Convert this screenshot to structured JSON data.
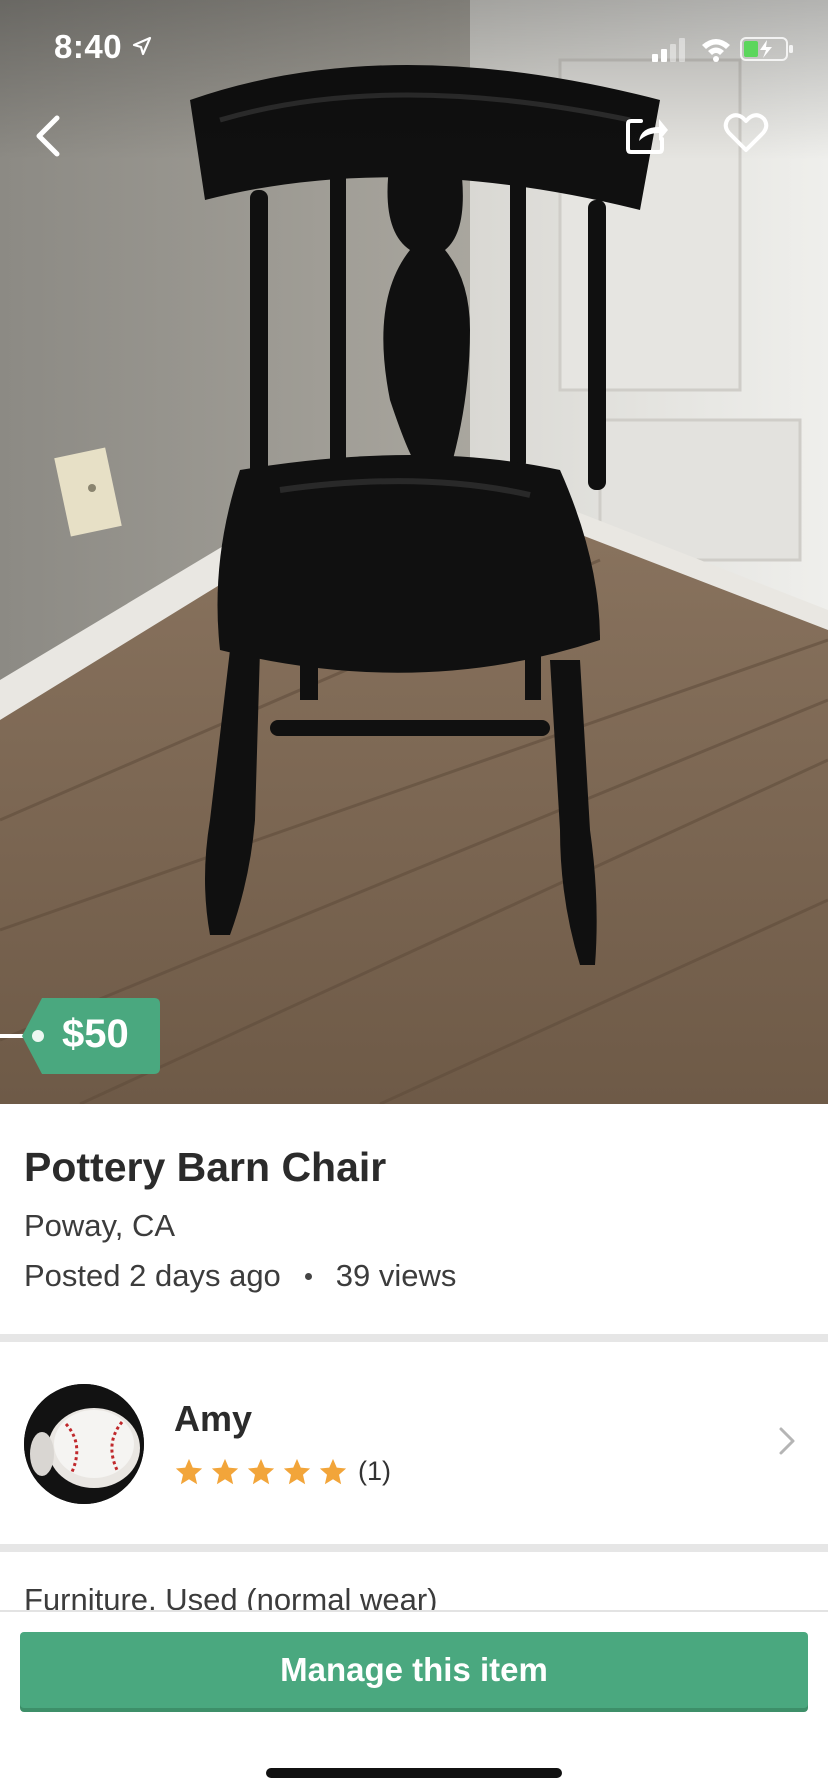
{
  "status_bar": {
    "time": "8:40"
  },
  "listing": {
    "price": "$50",
    "title": "Pottery Barn Chair",
    "location": "Poway, CA",
    "posted": "Posted 2 days ago",
    "views": "39 views",
    "details": "Furniture, Used (normal wear)"
  },
  "seller": {
    "name": "Amy",
    "rating_stars": 5,
    "rating_count": "(1)"
  },
  "actions": {
    "manage_label": "Manage this item"
  },
  "icons": {
    "back": "chevron-left-icon",
    "share": "share-icon",
    "favorite": "heart-icon",
    "seller_chevron": "chevron-right-icon",
    "star": "star-icon"
  },
  "colors": {
    "accent": "#4aa87f",
    "star": "#f2a53a",
    "divider": "#e6e6e6"
  }
}
